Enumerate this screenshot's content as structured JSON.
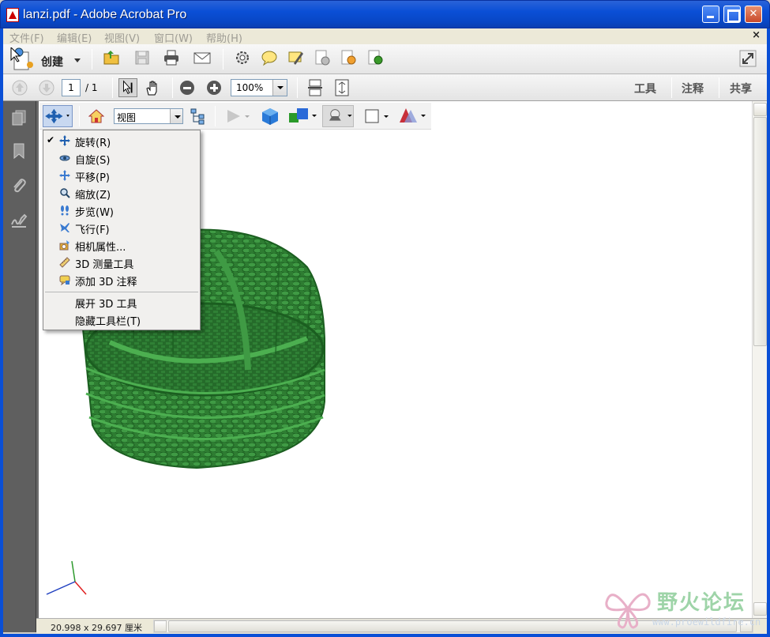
{
  "window": {
    "title": "lanzi.pdf - Adobe Acrobat Pro"
  },
  "menubar": {
    "items": [
      {
        "label": "文件(F)"
      },
      {
        "label": "编辑(E)"
      },
      {
        "label": "视图(V)"
      },
      {
        "label": "窗口(W)"
      },
      {
        "label": "帮助(H)"
      }
    ],
    "close_doc": "×"
  },
  "toolbar": {
    "create_label": "创建",
    "icons": [
      "open-icon",
      "save-icon",
      "print-icon",
      "email-icon",
      "settings-icon",
      "comment-icon",
      "sign-icon",
      "secure-icon",
      "review-icon",
      "export-icon"
    ]
  },
  "navigation": {
    "current_page": "1",
    "total_pages": "/ 1",
    "zoom": "100%",
    "right_links": [
      "工具",
      "注释",
      "共享"
    ]
  },
  "toolbar3d": {
    "view_value": "视图"
  },
  "tool_menu": {
    "items": [
      {
        "label": "旋转(R)",
        "checked": true,
        "icon": "rotate-icon"
      },
      {
        "label": "自旋(S)",
        "checked": false,
        "icon": "spin-icon"
      },
      {
        "label": "平移(P)",
        "checked": false,
        "icon": "pan-icon"
      },
      {
        "label": "缩放(Z)",
        "checked": false,
        "icon": "zoom-icon"
      },
      {
        "label": "步览(W)",
        "checked": false,
        "icon": "walk-icon"
      },
      {
        "label": "飞行(F)",
        "checked": false,
        "icon": "fly-icon"
      },
      {
        "label": "相机属性...",
        "checked": false,
        "icon": "camera-icon"
      },
      {
        "label": "3D 测量工具",
        "checked": false,
        "icon": "ruler-icon"
      },
      {
        "label": "添加 3D 注释",
        "checked": false,
        "icon": "annotation-icon"
      }
    ],
    "extra_items": [
      {
        "label": "展开 3D 工具"
      },
      {
        "label": "隐藏工具栏(T)"
      }
    ],
    "check_mark": "✔"
  },
  "status": {
    "page_size": "20.998 x 29.697 厘米"
  },
  "watermark": {
    "title": "野火论坛",
    "url": "www.proewildfire.cn"
  },
  "colors": {
    "basket_green": "#2e7d32",
    "titlebar": "#0a4fd6"
  }
}
